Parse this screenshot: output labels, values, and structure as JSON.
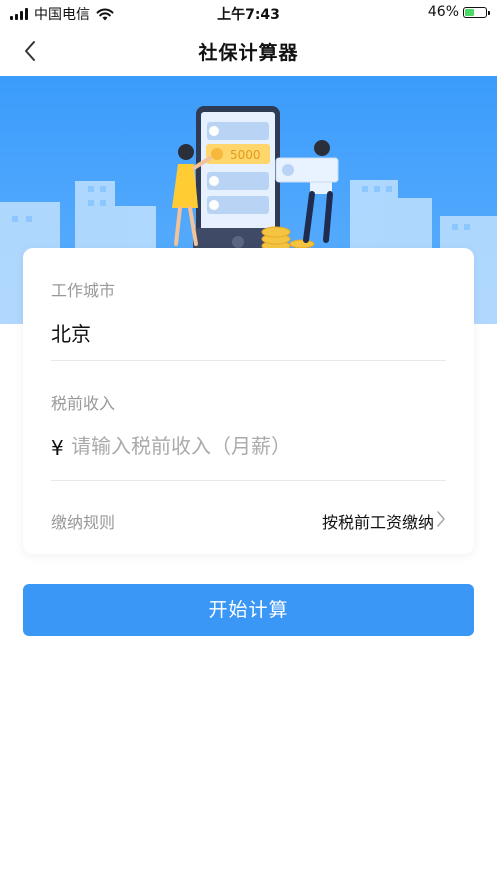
{
  "status_bar": {
    "carrier": "中国电信",
    "time": "上午7:43",
    "battery": "46%",
    "battery_level": 0.46
  },
  "nav": {
    "title": "社保计算器",
    "back_icon": "chevron-left-icon"
  },
  "banner": {
    "amount": "5000"
  },
  "form": {
    "city_label": "工作城市",
    "city_value": "北京",
    "income_label": "税前收入",
    "currency_symbol": "¥",
    "income_placeholder": "请输入税前收入（月薪）",
    "rule_label": "缴纳规则",
    "rule_value": "按税前工资缴纳"
  },
  "action": {
    "calculate_label": "开始计算"
  },
  "colors": {
    "primary": "#3b97f6",
    "banner": "#4aa3fc"
  }
}
